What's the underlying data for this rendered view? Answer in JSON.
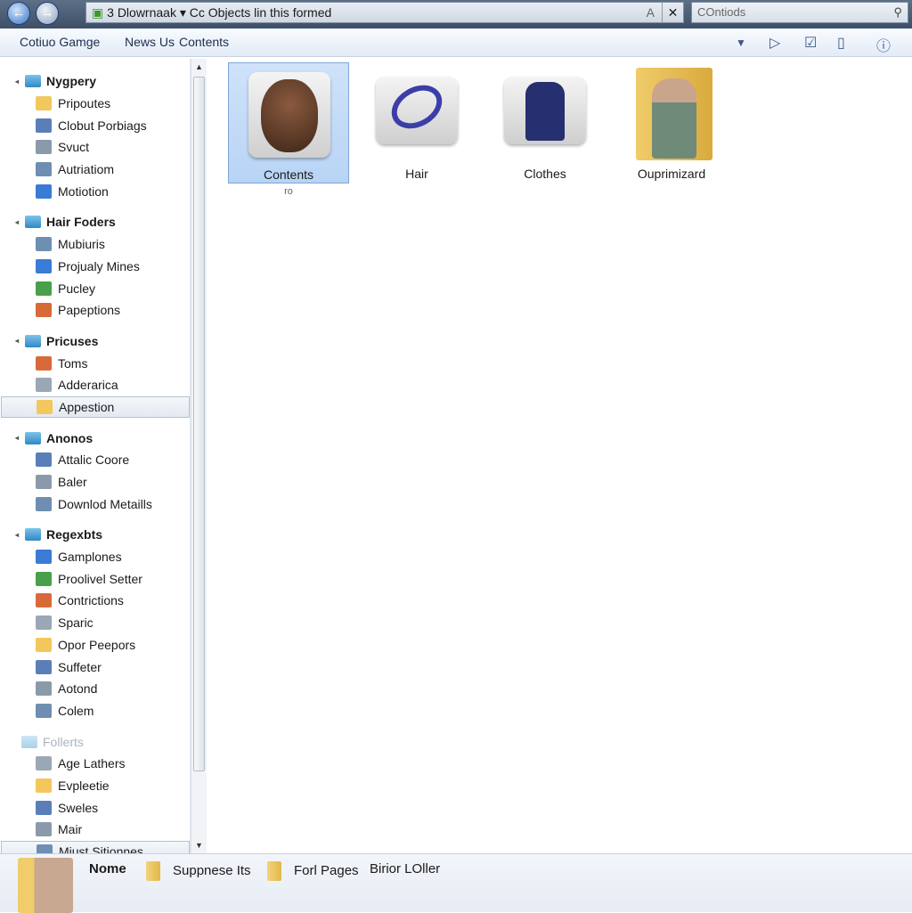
{
  "titlebar": {
    "address": "Dlowrnaak",
    "address_num": "3",
    "breadcrumb": "Cc Objects lin this formed",
    "search_placeholder": "COntiods"
  },
  "toolbar": {
    "items": [
      "Cotiuo Gamge",
      "News Us",
      "Contents"
    ]
  },
  "sidebar": {
    "groups": [
      {
        "label": "Nygpery",
        "items": [
          "Pripoutes",
          "Clobut Porbiags",
          "Svuct",
          "Autriatiom",
          "Motiotion"
        ]
      },
      {
        "label": "Hair Foders",
        "items": [
          "Mubiuris",
          "Projualy Mines",
          "Pucley",
          "Papeptions"
        ]
      },
      {
        "label": "Pricuses",
        "items": [
          "Toms",
          "Adderarica",
          "Appestion"
        ]
      },
      {
        "label": "Anonos",
        "items": [
          "Attalic Coore",
          "Baler",
          "Downlod Metaills"
        ]
      },
      {
        "label": "Regexbts",
        "items": [
          "Gamplones",
          "Proolivel Setter",
          "Contrictions",
          "Sparic",
          "Opor Peepors",
          "Suffeter",
          "Aotond",
          "Colem"
        ]
      },
      {
        "label": "Follerts",
        "items": [
          "Age Lathers",
          "Evpleetie",
          "Sweles",
          "Mair",
          "Miust Sitionnes"
        ]
      }
    ],
    "selected_item": "Appestion"
  },
  "content": {
    "tiles": [
      {
        "label": "Contents",
        "sub": "ro",
        "selected": true
      },
      {
        "label": "Hair",
        "selected": false
      },
      {
        "label": "Clothes",
        "selected": false
      },
      {
        "label": "Ouprimizard",
        "selected": false
      }
    ]
  },
  "footer": {
    "name": "Nome",
    "items": [
      "Suppnese Its",
      "Forl Pages",
      "Birior LOller"
    ]
  }
}
